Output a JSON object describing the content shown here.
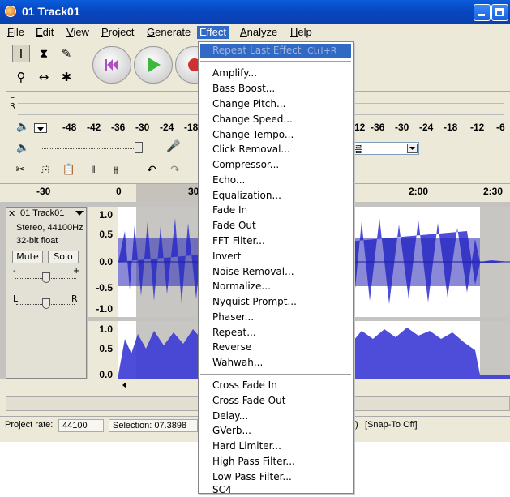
{
  "window": {
    "title": "01 Track01"
  },
  "menubar": [
    {
      "label": "File",
      "key": "F",
      "rest": "ile"
    },
    {
      "label": "Edit",
      "key": "E",
      "rest": "dit"
    },
    {
      "label": "View",
      "key": "V",
      "rest": "iew"
    },
    {
      "label": "Project",
      "key": "P",
      "rest": "roject"
    },
    {
      "label": "Generate",
      "key": "G",
      "rest": "enerate"
    },
    {
      "label": "Effect",
      "key": "",
      "rest": "Effect"
    },
    {
      "label": "Analyze",
      "key": "A",
      "rest": "nalyze"
    },
    {
      "label": "Help",
      "key": "H",
      "rest": "elp"
    }
  ],
  "meter": {
    "lr": [
      "L",
      "R"
    ],
    "left_ticks": [
      "-48",
      "-42",
      "-36",
      "-30",
      "-24",
      "-18"
    ],
    "right_ticks": [
      "12",
      "-36",
      "-30",
      "-24",
      "-18",
      "-12",
      "-6"
    ]
  },
  "device_select": {
    "value": "름"
  },
  "timeline": {
    "ticks": [
      "-30",
      "0",
      "30",
      "2:00",
      "2:30"
    ]
  },
  "track": {
    "name": "01 Track01",
    "info1": "Stereo, 44100Hz",
    "info2": "32-bit float",
    "mute_label": "Mute",
    "solo_label": "Solo",
    "pan_l": "L",
    "pan_r": "R",
    "gain_minus": "-",
    "gain_plus": "+",
    "scale1": [
      "1.0",
      "0.5",
      "0.0",
      "-0.5",
      "-1.0"
    ],
    "scale2": [
      "1.0",
      "0.5",
      "0.0"
    ]
  },
  "status": {
    "rate_label": "Project rate:",
    "rate_value": "44100",
    "selection": "Selection: 07.3898",
    "right_tail": ")",
    "snap": "[Snap-To Off]"
  },
  "effect_menu": {
    "repeat_last": "Repeat Last Effect",
    "repeat_shortcut": "Ctrl+R",
    "group1": [
      "Amplify...",
      "Bass Boost...",
      "Change Pitch...",
      "Change Speed...",
      "Change Tempo...",
      "Click Removal...",
      "Compressor...",
      "Echo...",
      "Equalization...",
      "Fade In",
      "Fade Out",
      "FFT Filter...",
      "Invert",
      "Noise Removal...",
      "Normalize...",
      "Nyquist Prompt...",
      "Phaser...",
      "Repeat...",
      "Reverse",
      "Wahwah..."
    ],
    "group2": [
      "Cross Fade In",
      "Cross Fade Out",
      "Delay...",
      "GVerb...",
      "Hard Limiter...",
      "High Pass Filter...",
      "Low Pass Filter...",
      "SC4"
    ]
  },
  "colors": {
    "wave": "#3a3ad6",
    "wave_dark": "#1c1caa",
    "selection_hl": "#316ac5",
    "titlebar": "#0a53d6"
  }
}
